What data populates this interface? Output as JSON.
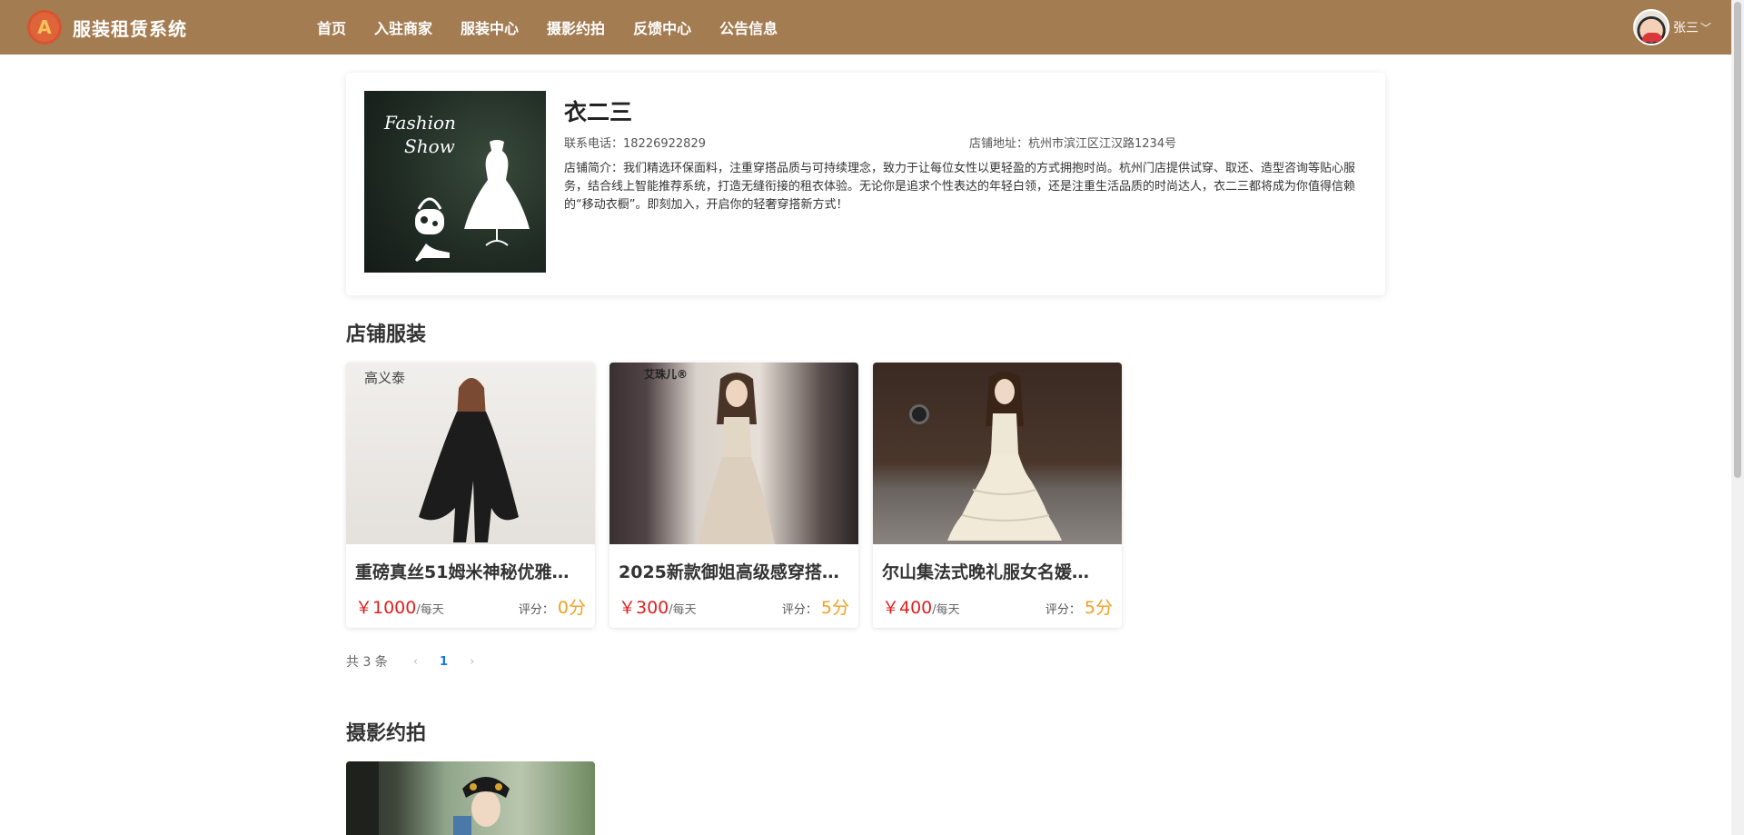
{
  "app": {
    "title": "服装租赁系统",
    "logo_glyph": "A"
  },
  "nav": [
    {
      "label": "首页"
    },
    {
      "label": "入驻商家"
    },
    {
      "label": "服装中心"
    },
    {
      "label": "摄影约拍"
    },
    {
      "label": "反馈中心"
    },
    {
      "label": "公告信息"
    }
  ],
  "user": {
    "name": "张三",
    "chevron": "﹀"
  },
  "shop": {
    "name": "衣二三",
    "phone": "联系电话：18226922829",
    "address": "店铺地址：杭州市滨江区江汉路1234号",
    "description": "店铺简介：我们精选环保面料，注重穿搭品质与可持续理念，致力于让每位女性以更轻盈的方式拥抱时尚。杭州门店提供试穿、取还、造型咨询等贴心服务，结合线上智能推荐系统，打造无缝衔接的租衣体验。无论你是追求个性表达的年轻白领，还是注重生活品质的时尚达人，衣二三都将成为你值得信赖的“移动衣橱”。即刻加入，开启你的轻奢穿搭新方式！",
    "image_text": [
      "Fashion",
      "Show"
    ]
  },
  "sections": {
    "clothing_title": "店铺服装",
    "photo_title": "摄影约拍"
  },
  "products": [
    {
      "title": "重磅真丝51姆米神秘优雅…",
      "price": "￥1000",
      "per_day": "/每天",
      "rating_label": "评分：",
      "rating": "0分",
      "watermark": "高义泰"
    },
    {
      "title": "2025新款御姐高级感穿搭…",
      "price": "￥300",
      "per_day": "/每天",
      "rating_label": "评分：",
      "rating": "5分",
      "watermark": "艾珠儿®"
    },
    {
      "title": "尔山集法式晚礼服女名媛…",
      "price": "￥400",
      "per_day": "/每天",
      "rating_label": "评分：",
      "rating": "5分",
      "watermark": ""
    }
  ],
  "pagination": {
    "total": "共 3 条",
    "prev": "‹",
    "current": "1",
    "next": "›"
  },
  "colors": {
    "header": "#a47c52",
    "price": "#e02020",
    "rating": "#f0a020",
    "page_active": "#1a73e8"
  }
}
